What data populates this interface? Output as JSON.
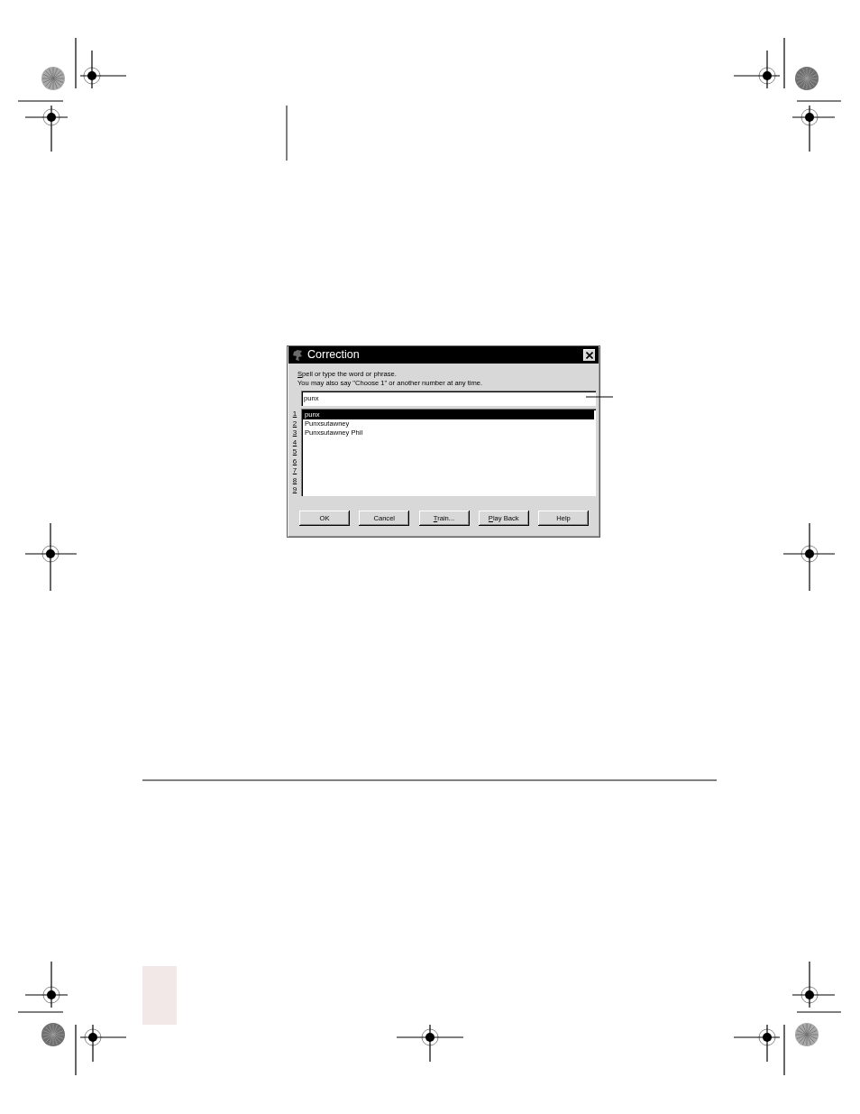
{
  "dialog": {
    "title": "Correction",
    "instructions": [
      {
        "text": "Spell or type the word or phrase.",
        "mnemonic": true
      },
      {
        "text": "You may also say \"Choose 1\" or another number at any time.",
        "mnemonic": false
      }
    ],
    "input": {
      "value": "punx"
    },
    "choice_numbers": [
      "1",
      "2",
      "3",
      "4",
      "5",
      "6",
      "7",
      "8",
      "9"
    ],
    "choices": [
      {
        "label": "punx",
        "selected": true
      },
      {
        "label": "Punxsutawney",
        "selected": false
      },
      {
        "label": "Punxsutawney Phil",
        "selected": false
      }
    ],
    "buttons": [
      {
        "label": "OK",
        "mnemonic": false
      },
      {
        "label": "Cancel",
        "mnemonic": false
      },
      {
        "label": "Train...",
        "mnemonic": true
      },
      {
        "label": "Play Back",
        "mnemonic": true
      },
      {
        "label": "Help",
        "mnemonic": false
      }
    ]
  }
}
